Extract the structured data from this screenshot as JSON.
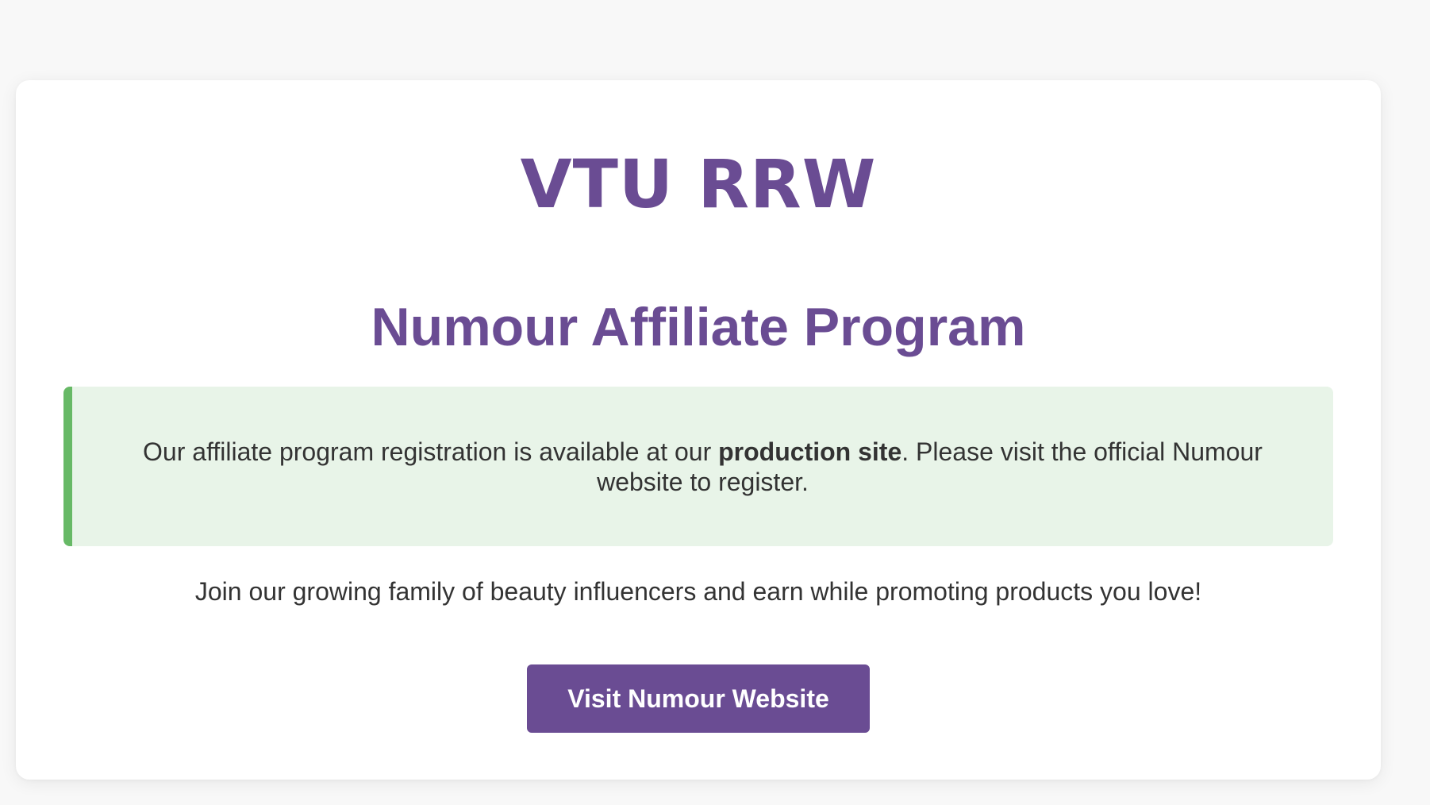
{
  "logo": {
    "text": "VTU RRW"
  },
  "page": {
    "title": "Numour Affiliate Program"
  },
  "notice": {
    "text_before": "Our affiliate program registration is available at our ",
    "emphasis": "production site",
    "text_after": ". Please visit the official Numour website to register."
  },
  "tagline": "Join our growing family of beauty influencers and earn while promoting products you love!",
  "cta": {
    "label": "Visit Numour Website"
  },
  "colors": {
    "background": "#f8f8f8",
    "card": "#ffffff",
    "brand_purple": "#6a4c93",
    "notice_background": "#e8f4e8",
    "notice_accent_green": "#67b966",
    "body_text": "#333333",
    "button_text": "#ffffff"
  }
}
